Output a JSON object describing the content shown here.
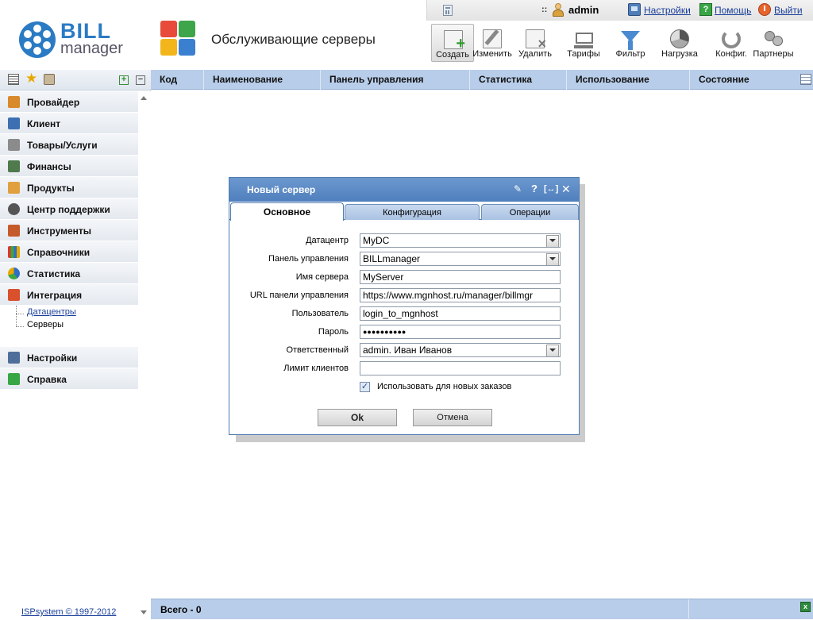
{
  "topbar": {
    "separator": "::",
    "username": "admin",
    "links": {
      "settings": "Настройки",
      "help": "Помощь",
      "logout": "Выйти"
    }
  },
  "logo": {
    "bill": "BILL",
    "manager": "manager"
  },
  "page_title": "Обслуживающие серверы",
  "toolbar": {
    "buttons": [
      {
        "label": "Создать",
        "icon": "create-icon"
      },
      {
        "label": "Изменить",
        "icon": "edit-icon"
      },
      {
        "label": "Удалить",
        "icon": "delete-icon"
      },
      {
        "label": "Тарифы",
        "icon": "cart-icon"
      },
      {
        "label": "Фильтр",
        "icon": "filter-icon"
      },
      {
        "label": "Нагрузка",
        "icon": "pie-chart-icon"
      },
      {
        "label": "Конфиг.",
        "icon": "config-icon"
      },
      {
        "label": "Партнеры",
        "icon": "partners-icon"
      }
    ]
  },
  "sidebar": {
    "items": [
      {
        "label": "Провайдер"
      },
      {
        "label": "Клиент"
      },
      {
        "label": "Товары/Услуги"
      },
      {
        "label": "Финансы"
      },
      {
        "label": "Продукты"
      },
      {
        "label": "Центр поддержки"
      },
      {
        "label": "Инструменты"
      },
      {
        "label": "Справочники"
      },
      {
        "label": "Статистика"
      },
      {
        "label": "Интеграция"
      },
      {
        "label": "Настройки"
      },
      {
        "label": "Справка"
      }
    ],
    "subitems": [
      {
        "label": "Датацентры"
      },
      {
        "label": "Серверы"
      }
    ]
  },
  "copyright": "ISPsystem © 1997-2012",
  "table": {
    "columns": [
      "Код",
      "Наименование",
      "Панель управления",
      "Статистика",
      "Использование",
      "Состояние"
    ],
    "footer_total": "Всего - 0"
  },
  "dialog": {
    "title": "Новый сервер",
    "controls": {
      "help": "?",
      "expand": "[↔]",
      "close": "✕"
    },
    "tabs": [
      "Основное",
      "Конфигурация",
      "Операции"
    ],
    "fields": [
      {
        "label": "Датацентр",
        "value": "MyDC"
      },
      {
        "label": "Панель управления",
        "value": "BILLmanager"
      },
      {
        "label": "Имя сервера",
        "value": "MyServer"
      },
      {
        "label": "URL панели управления",
        "value": "https://www.mgnhost.ru/manager/billmgr"
      },
      {
        "label": "Пользователь",
        "value": "login_to_mgnhost"
      },
      {
        "label": "Пароль",
        "value": "●●●●●●●●●●"
      },
      {
        "label": "Ответственный",
        "value": "admin. Иван Иванов"
      },
      {
        "label": "Лимит клиентов",
        "value": ""
      }
    ],
    "checkbox": {
      "label": "Использовать для новых заказов",
      "checked": true,
      "mark": "✓"
    },
    "ok_label": "Ok",
    "cancel_label": "Отмена"
  }
}
